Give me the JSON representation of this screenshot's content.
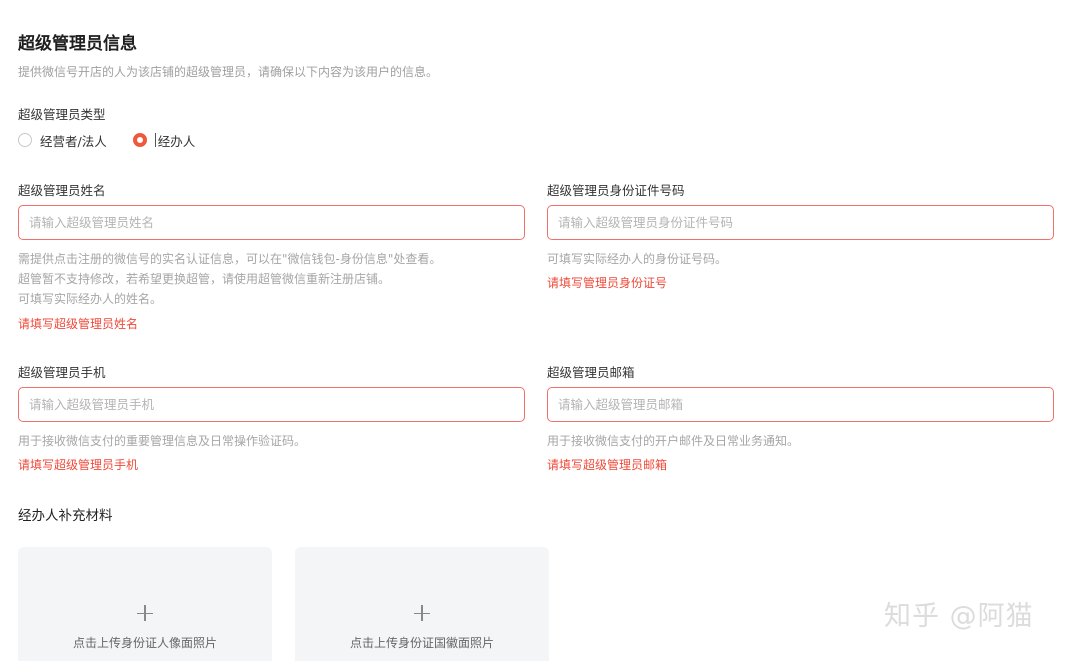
{
  "header": {
    "title": "超级管理员信息",
    "subtitle": "提供微信号开店的人为该店铺的超级管理员，请确保以下内容为该用户的信息。"
  },
  "admin_type": {
    "label": "超级管理员类型",
    "options": [
      {
        "label": "经营者/法人",
        "checked": false
      },
      {
        "label": "经办人",
        "checked": true
      }
    ]
  },
  "name_field": {
    "label": "超级管理员姓名",
    "placeholder": "请输入超级管理员姓名",
    "value": "",
    "help": [
      "需提供点击注册的微信号的实名认证信息，可以在\"微信钱包-身份信息\"处查看。",
      "超管暂不支持修改，若希望更换超管，请使用超管微信重新注册店铺。",
      "可填写实际经办人的姓名。"
    ],
    "error": "请填写超级管理员姓名"
  },
  "id_field": {
    "label": "超级管理员身份证件号码",
    "placeholder": "请输入超级管理员身份证件号码",
    "value": "",
    "help": [
      "可填写实际经办人的身份证号码。"
    ],
    "error": "请填写管理员身份证号"
  },
  "phone_field": {
    "label": "超级管理员手机",
    "placeholder": "请输入超级管理员手机",
    "value": "",
    "help": [
      "用于接收微信支付的重要管理信息及日常操作验证码。"
    ],
    "error": "请填写超级管理员手机"
  },
  "email_field": {
    "label": "超级管理员邮箱",
    "placeholder": "请输入超级管理员邮箱",
    "value": "",
    "help": [
      "用于接收微信支付的开户邮件及日常业务通知。"
    ],
    "error": "请填写超级管理员邮箱"
  },
  "materials": {
    "title": "经办人补充材料",
    "uploads": [
      {
        "label": "点击上传身份证人像面照片",
        "icon": "plus-icon"
      },
      {
        "label": "点击上传身份证国徽面照片",
        "icon": "plus-icon"
      }
    ]
  },
  "watermark": "知乎 @阿猫",
  "colors": {
    "accent": "#f0573c",
    "error": "#ef4a3a",
    "input_border_error": "#f0706a",
    "upload_bg": "#f4f5f7"
  }
}
